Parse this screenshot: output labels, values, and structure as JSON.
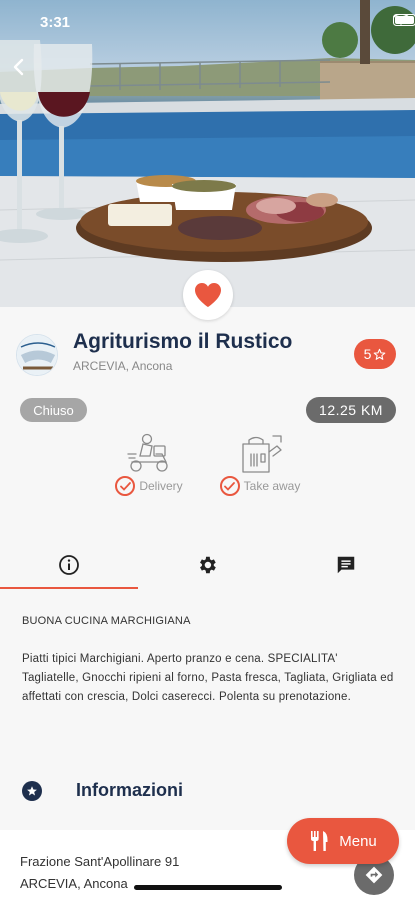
{
  "status_bar": {
    "time": "3:31"
  },
  "restaurant": {
    "name": "Agriturismo il Rustico",
    "location": "ARCEVIA, Ancona",
    "rating": "5",
    "logo_text": "rustico",
    "status": "Chiuso",
    "distance": "12.25 KM"
  },
  "services": {
    "delivery_label": "Delivery",
    "takeaway_label": "Take away"
  },
  "tabs": [
    {
      "icon": "info-icon",
      "active": true
    },
    {
      "icon": "gear-icon",
      "active": false
    },
    {
      "icon": "chat-icon",
      "active": false
    }
  ],
  "description": {
    "title": "BUONA CUCINA MARCHIGIANA",
    "body": "Piatti tipici Marchigiani. Aperto pranzo e cena. SPECIALITA' Tagliatelle, Gnocchi ripieni al forno, Pasta fresca, Tagliata, Grigliata ed affettati con crescia, Dolci casereccі. Polenta su prenotazione."
  },
  "info": {
    "title": "Informazioni",
    "address_line1": "Frazione Sant'Apollinare 91",
    "address_line2": "ARCEVIA, Ancona"
  },
  "menu_button": {
    "label": "Menu"
  },
  "colors": {
    "accent": "#e9573f",
    "navy": "#1e2f4d",
    "grey_badge": "#a6a6a6",
    "dark_badge": "#6b6b6b"
  }
}
